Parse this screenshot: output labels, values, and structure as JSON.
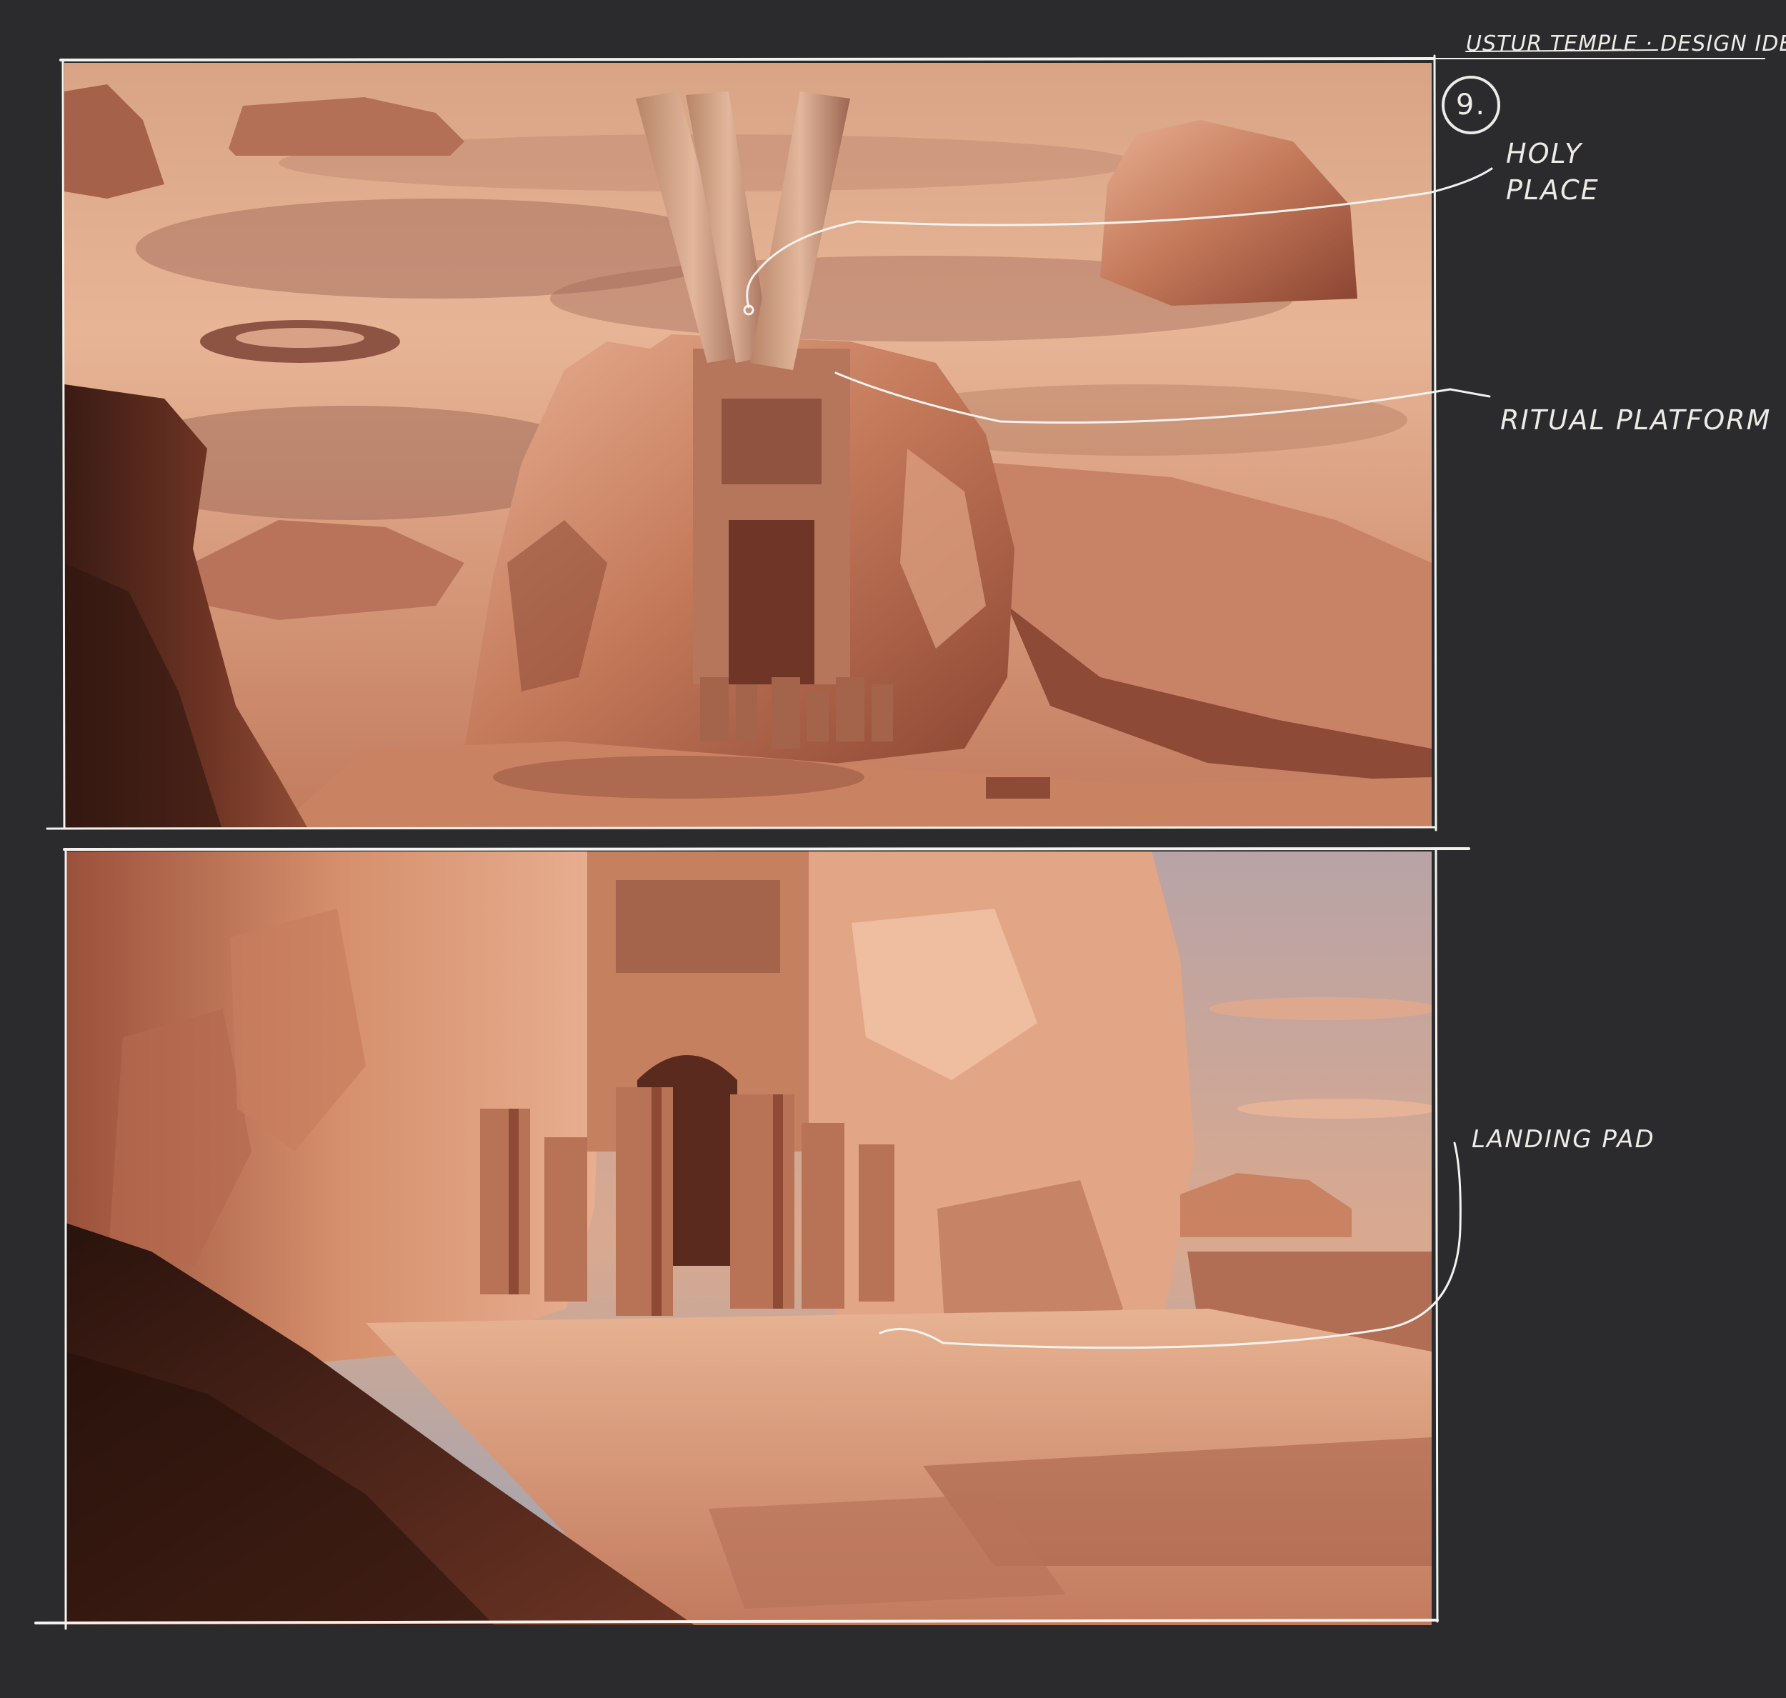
{
  "sheet": {
    "title": "USTUR TEMPLE · DESIGN IDEAS",
    "number": "9."
  },
  "panels": [
    {
      "name": "temple-aerial-view",
      "callouts": [
        {
          "label": "HOLY PLACE"
        },
        {
          "label": "RITUAL PLATFORM"
        }
      ]
    },
    {
      "name": "temple-ground-view",
      "callouts": [
        {
          "label": "LANDING PAD"
        }
      ]
    }
  ],
  "colors": {
    "background": "#2b2b2d",
    "ink": "#ecebe6",
    "sand_light": "#e9b28f",
    "sand_mid": "#c98262",
    "rock_shadow": "#7a3b2a",
    "rock_dark": "#3a1b14",
    "sky_blue": "#9aa4b6"
  }
}
